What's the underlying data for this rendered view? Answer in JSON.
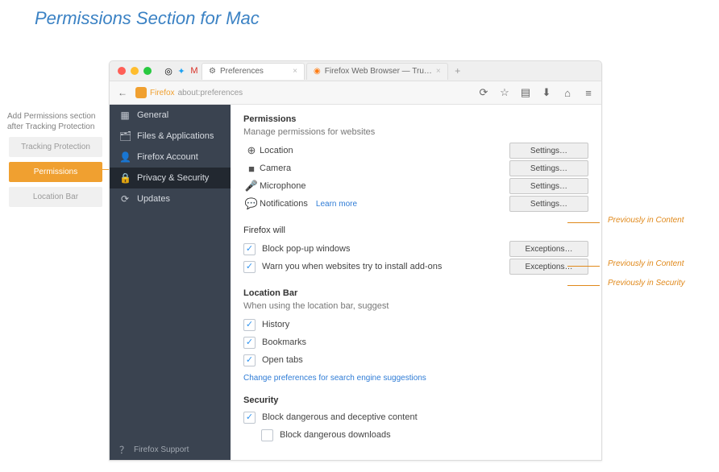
{
  "page": {
    "title": "Permissions Section for Mac"
  },
  "left_note": {
    "text": "Add Permissions section after Tracking Protection",
    "pills": [
      "Tracking Protection",
      "Permissions",
      "Location Bar"
    ],
    "active_index": 1
  },
  "window": {
    "tabs": [
      {
        "icon": "gear",
        "title": "Preferences",
        "close": "×"
      },
      {
        "icon": "firefox",
        "title": "Firefox Web Browser — Tru…",
        "close": "×"
      }
    ],
    "plus": "+",
    "toolbar": {
      "back": "←",
      "brand": "Firefox",
      "url": "about:preferences",
      "reload": "⟳",
      "icons": {
        "star": "☆",
        "stack": "▤",
        "down": "⬇",
        "home": "⌂",
        "menu": "≡"
      }
    },
    "sidebar": {
      "items": [
        {
          "icon": "▦",
          "label": "General"
        },
        {
          "icon": "🗂",
          "label": "Files & Applications"
        },
        {
          "icon": "👤",
          "label": "Firefox Account"
        },
        {
          "icon": "🔒",
          "label": "Privacy & Security"
        },
        {
          "icon": "⟳",
          "label": "Updates"
        }
      ],
      "selected_index": 3,
      "footer": {
        "icon": "？",
        "label": "Firefox Support"
      }
    },
    "content": {
      "permissions": {
        "heading": "Permissions",
        "subheading": "Manage permissions for websites",
        "rows": [
          {
            "icon": "⊕",
            "label": "Location",
            "btn": "Settings…"
          },
          {
            "icon": "■",
            "label": "Camera",
            "btn": "Settings…"
          },
          {
            "icon": "🎤",
            "label": "Microphone",
            "btn": "Settings…"
          },
          {
            "icon": "💬",
            "label": "Notifications",
            "btn": "Settings…",
            "learn": "Learn more"
          }
        ]
      },
      "firefox_will": {
        "heading": "Firefox will",
        "rows": [
          {
            "checked": true,
            "label": "Block pop-up windows",
            "btn": "Exceptions…"
          },
          {
            "checked": true,
            "label": "Warn you when websites try to install add-ons",
            "btn": "Exceptions…"
          }
        ]
      },
      "location_bar": {
        "heading": "Location Bar",
        "subheading": "When using the location bar, suggest",
        "rows": [
          {
            "checked": true,
            "label": "History"
          },
          {
            "checked": true,
            "label": "Bookmarks"
          },
          {
            "checked": true,
            "label": "Open tabs"
          }
        ],
        "link": "Change preferences for search engine suggestions"
      },
      "security": {
        "heading": "Security",
        "rows": [
          {
            "checked": true,
            "label": "Block dangerous and deceptive content"
          },
          {
            "checked": false,
            "label": "Block dangerous downloads",
            "indent": true
          }
        ]
      }
    }
  },
  "right_annotations": [
    "Previously in Content",
    "Previously in Content",
    "Previously in Security"
  ]
}
